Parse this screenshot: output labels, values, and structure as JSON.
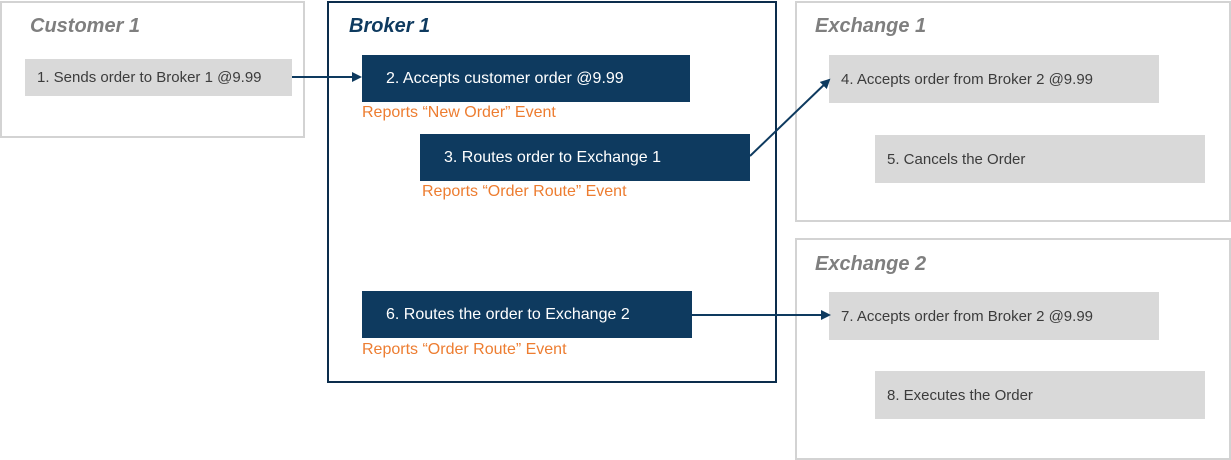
{
  "panels": {
    "customer": {
      "title": "Customer 1"
    },
    "broker": {
      "title": "Broker 1"
    },
    "exchange1": {
      "title": "Exchange 1"
    },
    "exchange2": {
      "title": "Exchange 2"
    }
  },
  "steps": {
    "s1": "1. Sends order to Broker 1 @9.99",
    "s2": "2. Accepts customer order @9.99",
    "s3": "3. Routes order to Exchange 1",
    "s4": "4. Accepts order from Broker 2 @9.99",
    "s5": "5. Cancels the Order",
    "s6": "6. Routes the order to Exchange 2",
    "s7": "7. Accepts order from Broker 2 @9.99",
    "s8": "8. Executes the Order"
  },
  "events": {
    "new_order": "Reports “New Order” Event",
    "order_route_1": "Reports “Order Route” Event",
    "order_route_2": "Reports “Order Route” Event"
  },
  "colors": {
    "navy": "#0e3a5f",
    "grey_box": "#d9d9d9",
    "event_orange": "#ed7d31",
    "panel_border": "#d3d3d3"
  }
}
